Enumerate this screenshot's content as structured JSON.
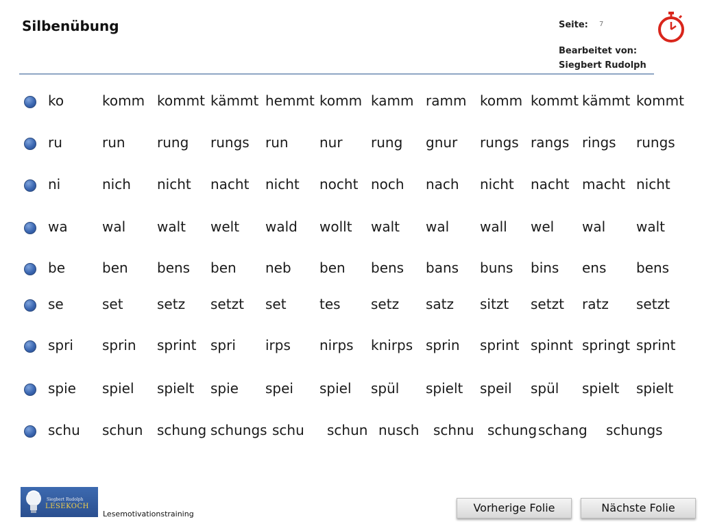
{
  "header": {
    "title": "Silbenübung",
    "page_label": "Seite:",
    "page_number": "7",
    "author_label": "Bearbeitet von:",
    "author_name": "Siegbert Rudolph"
  },
  "rows": [
    [
      "ko",
      "komm",
      "kommt",
      "kämmt",
      "hemmt",
      "komm",
      "kamm",
      "ramm",
      "komm",
      "kommt",
      "kämmt",
      "kommt"
    ],
    [
      "ru",
      "run",
      "rung",
      "rungs",
      "run",
      "nur",
      "rung",
      "gnur",
      "rungs",
      "rangs",
      "rings",
      "rungs"
    ],
    [
      "ni",
      "nich",
      "nicht",
      "nacht",
      "nicht",
      "nocht",
      "noch",
      "nach",
      "nicht",
      "nacht",
      "macht",
      "nicht"
    ],
    [
      "wa",
      "wal",
      "walt",
      "welt",
      "wald",
      "wollt",
      "walt",
      "wal",
      "wall",
      "wel",
      "wal",
      "walt"
    ],
    [
      "be",
      "ben",
      "bens",
      "ben",
      "neb",
      "ben",
      "bens",
      "bans",
      "buns",
      "bins",
      "ens",
      "bens"
    ],
    [
      "se",
      "set",
      "setz",
      "setzt",
      "set",
      "tes",
      "setz",
      "satz",
      "sitzt",
      "setzt",
      "ratz",
      "setzt"
    ],
    [
      "spri",
      "sprin",
      "sprint",
      "spri",
      "irps",
      "nirps",
      "knirps",
      "sprin",
      "sprint",
      "spinnt",
      "springt",
      "sprint"
    ],
    [
      "spie",
      "spiel",
      "spielt",
      "spie",
      "spei",
      "spiel",
      "spül",
      "spielt",
      "speil",
      "spül",
      "spielt",
      "spielt"
    ],
    [
      "schu",
      "schun",
      "schung",
      "schungs",
      "schu",
      "schun",
      "nusch",
      "schnu",
      "schung",
      "schang",
      "schungs"
    ]
  ],
  "footer": {
    "logo_small": "Siegbert Rudolph",
    "logo_big": "LESEKOCH",
    "label": "Lesemotivationstraining",
    "prev_button": "Vorherige Folie",
    "next_button": "Nächste Folie"
  },
  "icons": {
    "timer": "stopwatch-icon",
    "bullet": "blue-circle-bullet"
  },
  "colors": {
    "bullet": "#3c68b2",
    "timer": "#d9261c",
    "rule": "#8fa6c4",
    "logo_bg": "#2f5596"
  }
}
